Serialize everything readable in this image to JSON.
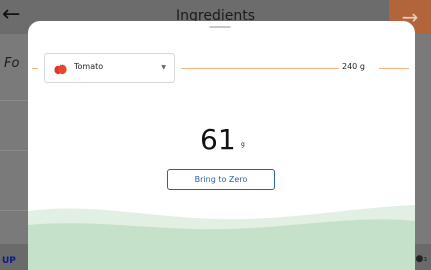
{
  "background": {
    "title": "Ingredients",
    "partial_label": "Fo",
    "bottom_label": "UP"
  },
  "sheet": {
    "ingredient": {
      "selected": "Tomato",
      "icon": "tomato-icon"
    },
    "max_weight": "240 g",
    "current_weight": "61",
    "unit": "g",
    "zero_button": "Bring to Zero"
  },
  "colors": {
    "accent": "#b2643a",
    "line": "#f2b383",
    "button": "#2d5fa6",
    "wave": "#c5e1c9"
  }
}
